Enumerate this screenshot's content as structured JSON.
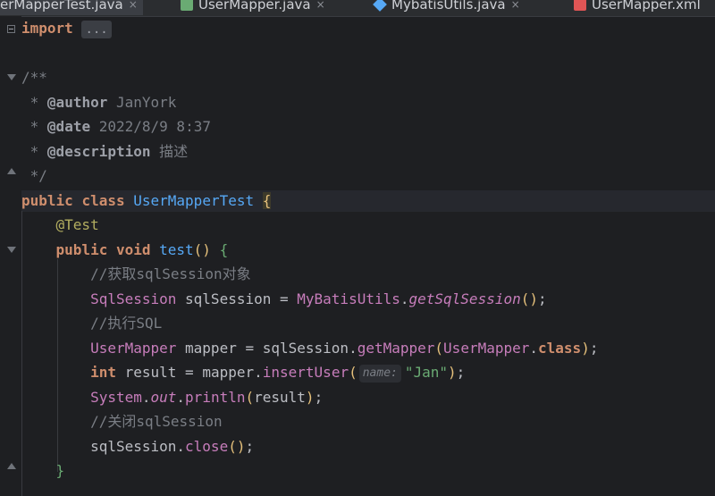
{
  "tabs": [
    {
      "label": "erMapperTest.java",
      "active": true
    },
    {
      "label": "UserMapper.java",
      "active": false
    },
    {
      "label": "MybatisUtils.java",
      "active": false
    },
    {
      "label": "UserMapper.xml",
      "active": false
    }
  ],
  "tab_close_glyph": "×",
  "code": {
    "import_kw": "import",
    "import_fold": "...",
    "doc_open": "/**",
    "doc_author_tag": "@author",
    "doc_author_val": "JanYork",
    "doc_date_tag": "@date",
    "doc_date_val": "2022/8/9 8:37",
    "doc_desc_tag": "@description",
    "doc_desc_val": "描述",
    "doc_close": "*/",
    "doc_star": "*",
    "kw_public": "public",
    "kw_class": "class",
    "class_name": "UserMapperTest",
    "annotation": "@Test",
    "kw_void": "void",
    "method_name": "test",
    "comment1": "//获取sqlSession对象",
    "sqlsession_type": "SqlSession",
    "sqlsession_var": "sqlSession",
    "utils_class": "MyBatisUtils",
    "get_sqlsession": "getSqlSession",
    "comment2": "//执行SQL",
    "mapper_type": "UserMapper",
    "mapper_var": "mapper",
    "get_mapper": "getMapper",
    "kw_class_lit": "class",
    "kw_int": "int",
    "result_var": "result",
    "insert_user": "insertUser",
    "param_hint": "name:",
    "string_arg": "\"Jan\"",
    "system": "System",
    "out": "out",
    "println": "println",
    "comment3": "//关闭sqlSession",
    "close": "close"
  }
}
